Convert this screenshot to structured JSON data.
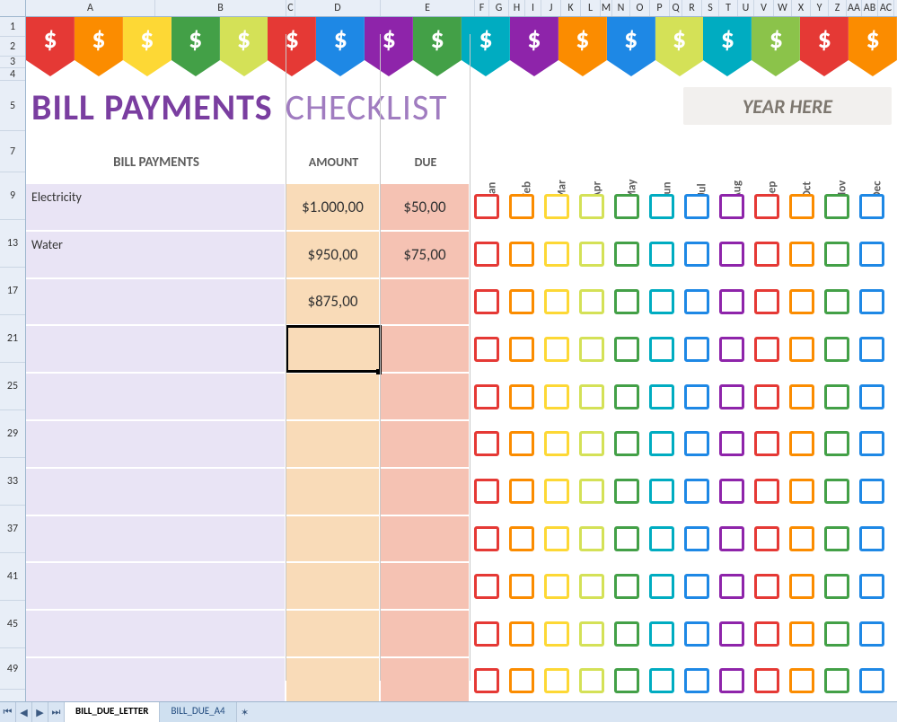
{
  "spreadsheet": {
    "col_letters": [
      "A",
      "B",
      "C",
      "D",
      "E",
      "F",
      "G",
      "H",
      "I",
      "J",
      "K",
      "L",
      "M",
      "N",
      "O",
      "P",
      "Q",
      "R",
      "S",
      "T",
      "U",
      "V",
      "W",
      "X",
      "Y",
      "Z",
      "AA",
      "AB",
      "AC"
    ],
    "visible_rows": [
      "1",
      "2",
      "3",
      "4",
      "5",
      "7",
      "9",
      "13",
      "17",
      "21",
      "25",
      "29",
      "33",
      "37",
      "41",
      "45",
      "49"
    ],
    "tabs": [
      "BILL_DUE_LETTER",
      "BILL_DUE_A4"
    ],
    "active_tab": 0,
    "selected_cell": "C21"
  },
  "title": {
    "strong": "BILL PAYMENTS",
    "light": "CHECKLIST",
    "year_placeholder": "YEAR HERE"
  },
  "headers": {
    "bill": "BILL PAYMENTS",
    "amount": "AMOUNT",
    "due": "DUE"
  },
  "months": [
    "Jan",
    "Feb",
    "Mar",
    "Apr",
    "May",
    "Jun",
    "Jul",
    "Aug",
    "Sep",
    "Oct",
    "Nov",
    "Dec"
  ],
  "month_colors": [
    "#e53935",
    "#fb8c00",
    "#fdd835",
    "#d4e157",
    "#43a047",
    "#00acc1",
    "#1e88e5",
    "#8e24aa",
    "#e53935",
    "#fb8c00",
    "#43a047",
    "#1e88e5"
  ],
  "pennant_colors": [
    "#e53935",
    "#fb8c00",
    "#fdd835",
    "#43a047",
    "#d4e157",
    "#e53935",
    "#1e88e5",
    "#8e24aa",
    "#43a047",
    "#00acc1",
    "#8e24aa",
    "#fb8c00",
    "#1e88e5",
    "#d4e157",
    "#00acc1",
    "#8bc34a",
    "#e53935",
    "#fb8c00"
  ],
  "rows": [
    {
      "bill": "Electricity",
      "amount": "$1.000,00",
      "due": "$50,00"
    },
    {
      "bill": "Water",
      "amount": "$950,00",
      "due": "$75,00"
    },
    {
      "bill": "",
      "amount": "$875,00",
      "due": ""
    },
    {
      "bill": "",
      "amount": "",
      "due": ""
    },
    {
      "bill": "",
      "amount": "",
      "due": ""
    },
    {
      "bill": "",
      "amount": "",
      "due": ""
    },
    {
      "bill": "",
      "amount": "",
      "due": ""
    },
    {
      "bill": "",
      "amount": "",
      "due": ""
    },
    {
      "bill": "",
      "amount": "",
      "due": ""
    },
    {
      "bill": "",
      "amount": "",
      "due": ""
    },
    {
      "bill": "",
      "amount": "",
      "due": ""
    }
  ],
  "chart_data": {
    "type": "table",
    "title": "BILL PAYMENTS CHECKLIST",
    "columns": [
      "BILL PAYMENTS",
      "AMOUNT",
      "DUE",
      "Jan",
      "Feb",
      "Mar",
      "Apr",
      "May",
      "Jun",
      "Jul",
      "Aug",
      "Sep",
      "Oct",
      "Nov",
      "Dec"
    ],
    "rows": [
      [
        "Electricity",
        "$1.000,00",
        "$50,00",
        "",
        "",
        "",
        "",
        "",
        "",
        "",
        "",
        "",
        "",
        "",
        ""
      ],
      [
        "Water",
        "$950,00",
        "$75,00",
        "",
        "",
        "",
        "",
        "",
        "",
        "",
        "",
        "",
        "",
        "",
        ""
      ],
      [
        "",
        "$875,00",
        "",
        "",
        "",
        "",
        "",
        "",
        "",
        "",
        "",
        "",
        "",
        "",
        ""
      ]
    ]
  }
}
